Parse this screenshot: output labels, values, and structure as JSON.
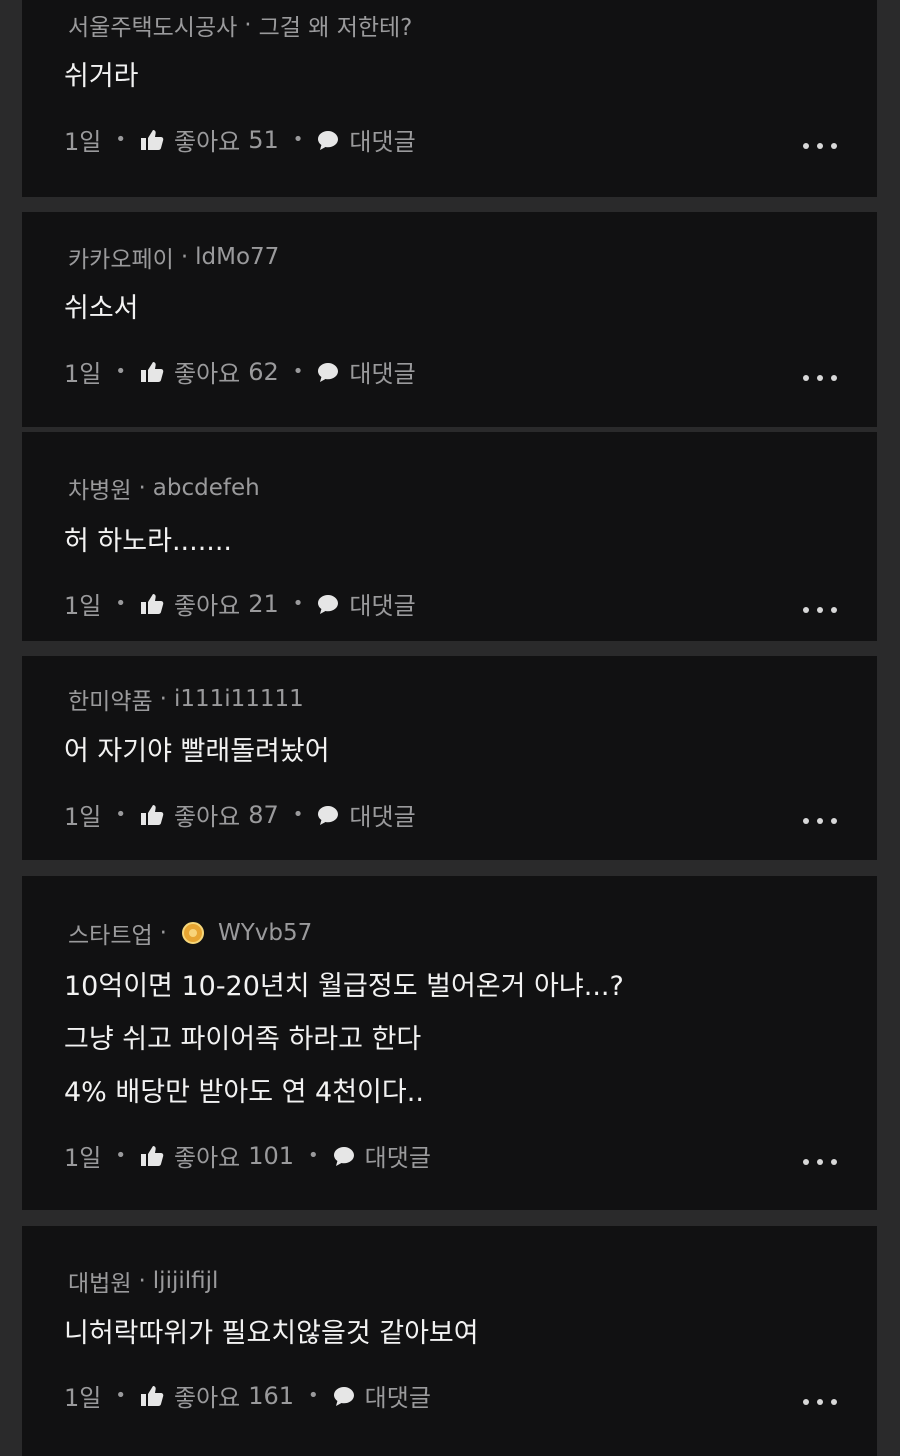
{
  "comments": [
    {
      "company": "서울주택도시공사",
      "nickname": "그걸 왜 저한테?",
      "has_badge": false,
      "lines": [
        "쉬거라"
      ],
      "time": "1일",
      "like_label": "좋아요",
      "likes": "51",
      "reply_label": "대댓글"
    },
    {
      "company": "카카오페이",
      "nickname": "ldMo77",
      "has_badge": false,
      "lines": [
        "쉬소서"
      ],
      "time": "1일",
      "like_label": "좋아요",
      "likes": "62",
      "reply_label": "대댓글"
    },
    {
      "company": "차병원",
      "nickname": "abcdefeh",
      "has_badge": false,
      "lines": [
        "허 하노라......."
      ],
      "time": "1일",
      "like_label": "좋아요",
      "likes": "21",
      "reply_label": "대댓글"
    },
    {
      "company": "한미약품",
      "nickname": "i111i11111",
      "has_badge": false,
      "lines": [
        "어 자기야 빨래돌려놨어"
      ],
      "time": "1일",
      "like_label": "좋아요",
      "likes": "87",
      "reply_label": "대댓글"
    },
    {
      "company": "스타트업",
      "nickname": "WYvb57",
      "has_badge": true,
      "lines": [
        "10억이면 10-20년치 월급정도 벌어온거 아냐...?",
        "그냥 쉬고 파이어족 하라고 한다",
        "4% 배당만 받아도 연 4천이다.."
      ],
      "time": "1일",
      "like_label": "좋아요",
      "likes": "101",
      "reply_label": "대댓글"
    },
    {
      "company": "대법원",
      "nickname": "ljijilfijl",
      "has_badge": false,
      "lines": [
        "니허락따위가 필요치않을것 같아보여"
      ],
      "time": "1일",
      "like_label": "좋아요",
      "likes": "161",
      "reply_label": "대댓글"
    }
  ],
  "icons": {
    "like": "thumbs-up-icon",
    "reply": "speech-bubble-icon",
    "more": "more-dots-icon",
    "badge": "gold-badge-icon"
  },
  "colors": {
    "card_bg": "#111112",
    "page_bg": "#2a2a2b",
    "text": "#f2f2f2",
    "muted": "#9a9a9c"
  }
}
